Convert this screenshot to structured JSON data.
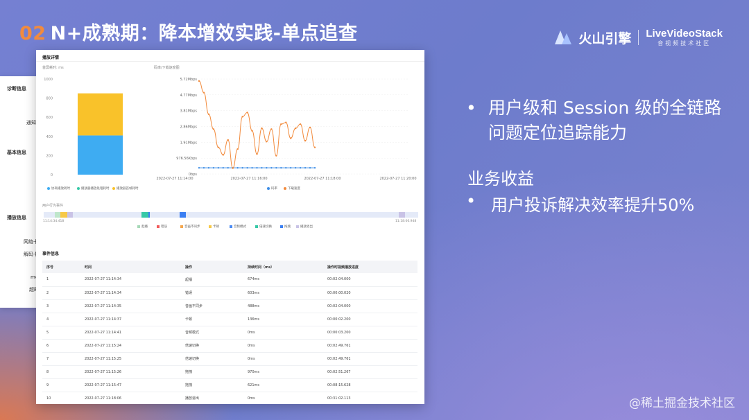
{
  "slide": {
    "number": "02",
    "title": "N+成熟期：降本增效实践-单点追查",
    "logo_brand": "火山引擎",
    "logo_brand2": "LiveVideoStack",
    "logo_sub": "音视频技术社区",
    "watermark": "@稀土掘金技术社区"
  },
  "bullets": [
    "用户级和 Session 级的全链路问题定位追踪能力"
  ],
  "benefit_title": "业务收益",
  "benefit_bullet": "用户投诉解决效率提升50%",
  "side_panel": {
    "items": [
      "诊断信息",
      "通知",
      "基本信息",
      "播放信息",
      "网络卡",
      "解码卡",
      "mc",
      "超时"
    ]
  },
  "panel": {
    "title": "播放详情",
    "bar_chart_label": "首屏耗时: ms",
    "line_chart_label": "码率/下载速度图",
    "behavior_label": "用户行为事件",
    "timeline_start": "11:14:34.418",
    "timeline_end": "11:18:06.948",
    "events_title": "事件信息",
    "table_headers": [
      "序号",
      "时间",
      "操作",
      "持续时间（ms）",
      "操作时视频播放进度"
    ],
    "table_rows": [
      [
        "1",
        "2022-07-27 11:14:34",
        "起播",
        "674ms",
        "00:02:04.000"
      ],
      [
        "2",
        "2022-07-27 11:14:34",
        "错误",
        "603ms",
        "00:00:00.020"
      ],
      [
        "3",
        "2022-07-27 11:14:35",
        "音画不同步",
        "488ms",
        "00:02:04.000"
      ],
      [
        "4",
        "2022-07-27 11:14:37",
        "卡顿",
        "136ms",
        "00:00:02.200"
      ],
      [
        "5",
        "2022-07-27 11:14:41",
        "音频模式",
        "0ms",
        "00:00:03.200"
      ],
      [
        "6",
        "2022-07-27 11:15:24",
        "倍速切换",
        "0ms",
        "00:02:49.761"
      ],
      [
        "7",
        "2022-07-27 11:15:25",
        "倍速切换",
        "0ms",
        "00:02:49.761"
      ],
      [
        "8",
        "2022-07-27 11:15:26",
        "拖拽",
        "970ms",
        "00:02:51.267"
      ],
      [
        "9",
        "2022-07-27 11:15:47",
        "拖拽",
        "621ms",
        "00:08:15.628"
      ],
      [
        "10",
        "2022-07-27 11:18:06",
        "播放退出",
        "0ms",
        "00:31:02.113"
      ]
    ],
    "behavior_legend": [
      "起播",
      "错误",
      "音画不同步",
      "卡顿",
      "音频模式",
      "倍速切换",
      "拖拽",
      "播放退出"
    ],
    "behavior_colors": [
      "#a7d9b8",
      "#f25b5b",
      "#f4a64d",
      "#f7c948",
      "#4b8bf4",
      "#37c9a7",
      "#3b7ff2",
      "#c9c3e6"
    ]
  },
  "chart_data": [
    {
      "type": "bar",
      "title": "首屏耗时: ms",
      "categories": [
        ""
      ],
      "series": [
        {
          "name": "协商播放耗时",
          "values": [
            410
          ],
          "color": "#3eacf2"
        },
        {
          "name": "播放器播放处理耗时",
          "values": [
            440
          ],
          "color": "#f9c22a"
        },
        {
          "name": "播放器首帧耗时",
          "values": [
            0
          ],
          "color": "#f9c22a"
        }
      ],
      "stacked": true,
      "ylim": [
        0,
        1000
      ],
      "yticks": [
        "1000",
        "800",
        "600",
        "400",
        "200",
        "0"
      ],
      "legend": "bottom"
    },
    {
      "type": "line",
      "title": "码率/下载速度图",
      "yticks": [
        "5.72Mbps",
        "4.77Mbps",
        "3.81Mbps",
        "2.86Mbps",
        "1.91Mbps",
        "976.56Kbps",
        "0bps"
      ],
      "xticks": [
        "2022-07-27 11:14:00",
        "2022-07-27 11:16:00",
        "2022-07-27 11:18:00",
        "2022-07-27 11:20:00"
      ],
      "ylim": [
        0,
        5.72
      ],
      "series": [
        {
          "name": "码率",
          "color": "#3e8ee6",
          "values": [
            0.37,
            0.37,
            0.37,
            0.37,
            0.37,
            0.37,
            0.37,
            0.37,
            0.37,
            0.37,
            0.37,
            0.37,
            0.37,
            0.37,
            0.37,
            0.37,
            0.37,
            0.37,
            0.37,
            0.37,
            0.37,
            0.37,
            0.37,
            0.37,
            0.37
          ]
        },
        {
          "name": "下载速度",
          "color": "#f28b3d",
          "values": [
            5.6,
            4.9,
            3.6,
            2.7,
            1.6,
            1.15,
            2.05,
            0.35,
            1.5,
            3.45,
            3.7,
            2.6,
            1.2,
            2.75,
            1.95,
            2.7,
            1.1,
            3.0,
            3.1,
            2.15,
            2.75,
            3.0,
            2.0,
            2.8,
            1.6
          ]
        }
      ],
      "legend": "bottom"
    }
  ]
}
